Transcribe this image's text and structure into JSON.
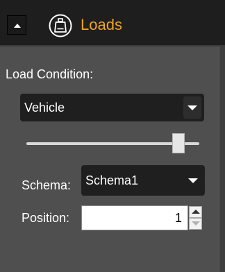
{
  "header": {
    "title": "Loads",
    "collapse_icon": "chevron-up-icon",
    "section_icon": "load-weight-icon",
    "title_color": "#f0a422"
  },
  "load_condition": {
    "label": "Load Condition:",
    "selected": "Vehicle"
  },
  "slider": {
    "level": 0.88
  },
  "schema": {
    "label": "Schema:",
    "selected": "Schema1"
  },
  "position": {
    "label": "Position:",
    "value": "1"
  }
}
